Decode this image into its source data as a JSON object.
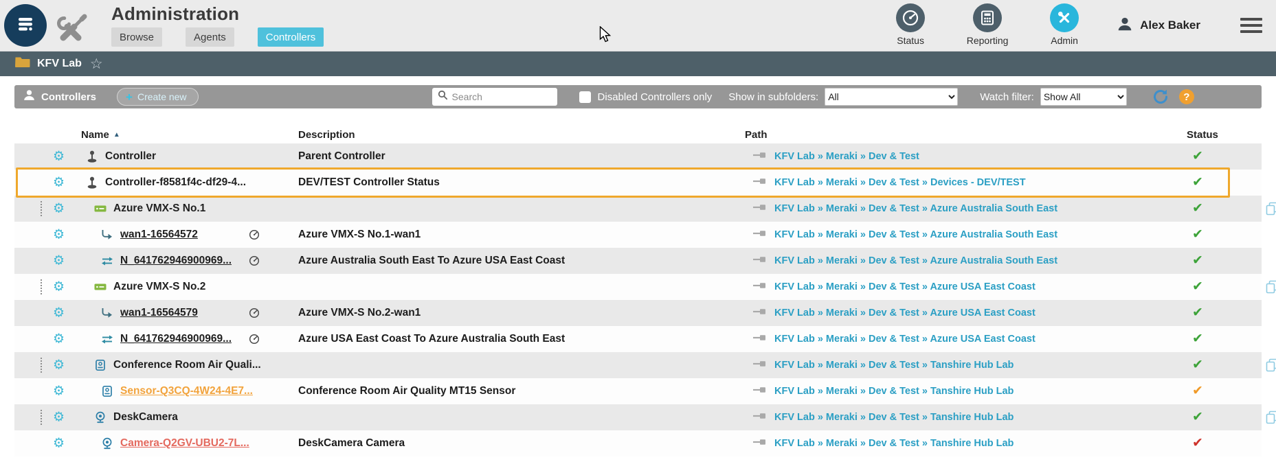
{
  "header": {
    "title": "Administration",
    "tabs": [
      {
        "label": "Browse",
        "active": false
      },
      {
        "label": "Agents",
        "active": false
      },
      {
        "label": "Controllers",
        "active": true
      }
    ],
    "quick_nav": [
      {
        "label": "Status"
      },
      {
        "label": "Reporting"
      },
      {
        "label": "Admin"
      }
    ],
    "user_name": "Alex Baker"
  },
  "breadcrumb": {
    "folder_name": "KFV Lab"
  },
  "toolbar": {
    "section_label": "Controllers",
    "create_new_label": "Create new",
    "search_placeholder": "Search",
    "disabled_filter_label": "Disabled Controllers only",
    "disabled_filter_checked": false,
    "subfolders_label": "Show in subfolders:",
    "subfolders_value": "All",
    "watch_filter_label": "Watch filter:",
    "watch_filter_value": "Show All"
  },
  "table": {
    "columns": [
      "Name",
      "Description",
      "Path",
      "Status"
    ],
    "sorted_by": "Name",
    "sort_direction": "asc",
    "rows": [
      {
        "icon": "controller",
        "name": "Controller",
        "link": false,
        "gauge": false,
        "description": "Parent Controller",
        "path": "KFV Lab » Meraki » Dev & Test",
        "status": "ok",
        "indent": 0,
        "highlighted": false,
        "drag": false,
        "copy": false
      },
      {
        "icon": "controller",
        "name": "Controller-f8581f4c-df29-4...",
        "link": false,
        "gauge": false,
        "description": "DEV/TEST Controller Status",
        "path": "KFV Lab » Meraki » Dev & Test » Devices - DEV/TEST",
        "status": "ok",
        "indent": 0,
        "highlighted": true,
        "drag": false,
        "copy": false
      },
      {
        "icon": "appliance",
        "name": "Azure VMX-S No.1",
        "link": false,
        "gauge": false,
        "description": "",
        "path": "KFV Lab » Meraki » Dev & Test » Azure Australia South East",
        "status": "ok",
        "indent": 1,
        "highlighted": false,
        "drag": true,
        "copy": true
      },
      {
        "icon": "wan",
        "name": "wan1-16564572",
        "link": true,
        "gauge": true,
        "description": "Azure VMX-S No.1-wan1",
        "path": "KFV Lab » Meraki » Dev & Test » Azure Australia South East",
        "status": "ok",
        "indent": 2,
        "highlighted": false,
        "drag": false,
        "copy": false
      },
      {
        "icon": "vpn",
        "name": "N_641762946900969...",
        "link": true,
        "gauge": true,
        "description": "Azure Australia South East To Azure USA East Coast",
        "path": "KFV Lab » Meraki » Dev & Test » Azure Australia South East",
        "status": "ok",
        "indent": 2,
        "highlighted": false,
        "drag": false,
        "copy": false
      },
      {
        "icon": "appliance",
        "name": "Azure VMX-S No.2",
        "link": false,
        "gauge": false,
        "description": "",
        "path": "KFV Lab » Meraki » Dev & Test » Azure USA East Coast",
        "status": "ok",
        "indent": 1,
        "highlighted": false,
        "drag": true,
        "copy": true
      },
      {
        "icon": "wan",
        "name": "wan1-16564579",
        "link": true,
        "gauge": true,
        "description": "Azure VMX-S No.2-wan1",
        "path": "KFV Lab » Meraki » Dev & Test » Azure USA East Coast",
        "status": "ok",
        "indent": 2,
        "highlighted": false,
        "drag": false,
        "copy": false
      },
      {
        "icon": "vpn",
        "name": "N_641762946900969...",
        "link": true,
        "gauge": true,
        "description": "Azure USA East Coast To Azure Australia South East",
        "path": "KFV Lab » Meraki » Dev & Test » Azure USA East Coast",
        "status": "ok",
        "indent": 2,
        "highlighted": false,
        "drag": false,
        "copy": false
      },
      {
        "icon": "sensor",
        "name": "Conference Room Air Quali...",
        "link": false,
        "gauge": false,
        "description": "",
        "path": "KFV Lab » Meraki » Dev & Test » Tanshire Hub Lab",
        "status": "ok",
        "indent": 1,
        "highlighted": false,
        "drag": true,
        "copy": true
      },
      {
        "icon": "sensor",
        "name": "Sensor-Q3CQ-4W24-4E7...",
        "link": true,
        "name_color": "#f2a33c",
        "gauge": false,
        "description": "Conference Room Air Quality MT15 Sensor",
        "path": "KFV Lab » Meraki » Dev & Test » Tanshire Hub Lab",
        "status": "warning",
        "indent": 2,
        "highlighted": false,
        "drag": false,
        "copy": false
      },
      {
        "icon": "camera",
        "name": "DeskCamera",
        "link": false,
        "gauge": false,
        "description": "",
        "path": "KFV Lab » Meraki » Dev & Test » Tanshire Hub Lab",
        "status": "ok",
        "indent": 1,
        "highlighted": false,
        "drag": true,
        "copy": true
      },
      {
        "icon": "camera",
        "name": "Camera-Q2GV-UBU2-7L...",
        "link": true,
        "name_color": "#e4695e",
        "gauge": false,
        "description": "DeskCamera Camera",
        "path": "KFV Lab » Meraki » Dev & Test » Tanshire Hub Lab",
        "status": "error",
        "indent": 2,
        "highlighted": false,
        "drag": false,
        "copy": false
      }
    ]
  },
  "icons": {
    "logo": "list-lines-in-circle",
    "administration": "crossed-wrench-screwdriver",
    "status_nav": "gauge",
    "reporting_nav": "calculator",
    "admin_nav": "crossed-tools",
    "user": "person-silhouette",
    "menu": "hamburger",
    "folder": "folder",
    "favorite": "☆",
    "controllers_section": "person-silhouette",
    "create_plus": "+",
    "search": "magnifier",
    "refresh": "circular-arrow",
    "help": "?",
    "gear": "⚙",
    "sort_asc": "▲",
    "status_check": "✔"
  },
  "colors": {
    "accent_cyan": "#4fc1dc",
    "toolbar_gray": "#979797",
    "breadcrumb_slate": "#4e6069",
    "path_link": "#2b9fc4",
    "status_ok": "#3da339",
    "status_warning": "#f09a28",
    "status_error": "#ce332b",
    "highlight_outline": "#efa82c",
    "row_stripe": "#e9e9e9"
  }
}
